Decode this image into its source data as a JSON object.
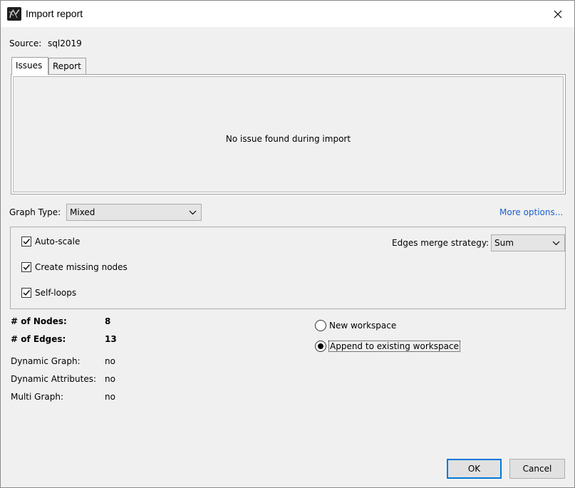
{
  "window": {
    "title": "Import report",
    "icon": "gephi-app-icon",
    "close_icon": "close-icon"
  },
  "source": {
    "label": "Source:",
    "value": "sql2019"
  },
  "tabs": [
    {
      "label": "Issues",
      "active": true
    },
    {
      "label": "Report",
      "active": false
    }
  ],
  "issues_panel": {
    "message": "No issue found during import"
  },
  "graph_type": {
    "label": "Graph Type:",
    "selected": "Mixed"
  },
  "more_options": "More options...",
  "options": {
    "auto_scale": {
      "label": "Auto-scale",
      "checked": true
    },
    "create_missing_nodes": {
      "label": "Create missing nodes",
      "checked": true
    },
    "self_loops": {
      "label": "Self-loops",
      "checked": true
    },
    "edges_merge": {
      "label": "Edges merge strategy:",
      "selected": "Sum"
    }
  },
  "stats": {
    "nodes_label": "# of Nodes:",
    "nodes_value": "8",
    "edges_label": "# of Edges:",
    "edges_value": "13",
    "dynamic_graph_label": "Dynamic Graph:",
    "dynamic_graph_value": "no",
    "dynamic_attributes_label": "Dynamic Attributes:",
    "dynamic_attributes_value": "no",
    "multi_graph_label": "Multi Graph:",
    "multi_graph_value": "no"
  },
  "workspace": {
    "new_label": "New workspace",
    "append_label": "Append to existing workspace",
    "selected": "append"
  },
  "buttons": {
    "ok": "OK",
    "cancel": "Cancel"
  },
  "colors": {
    "link": "#1a5fd0",
    "focus_border": "#0078d7"
  }
}
